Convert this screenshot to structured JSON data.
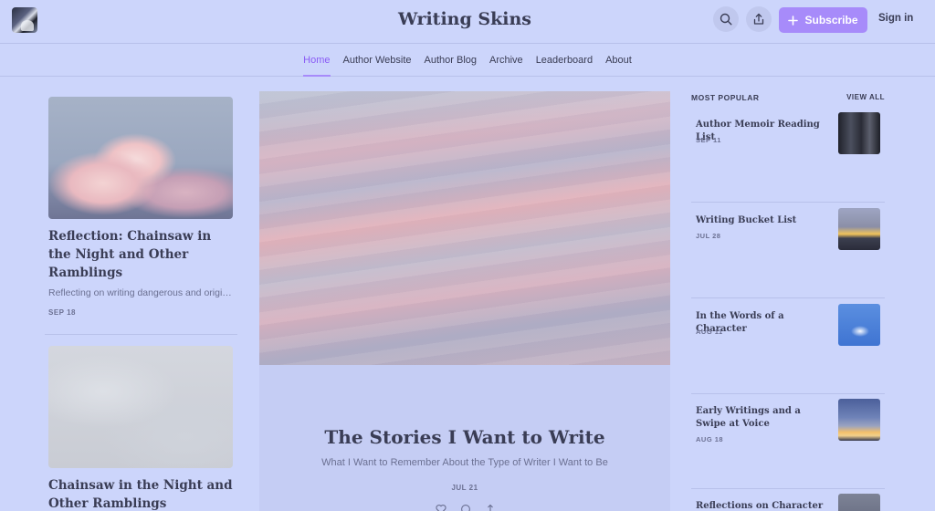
{
  "header": {
    "site_title": "Writing Skins",
    "subscribe_label": "Subscribe",
    "signin_label": "Sign in"
  },
  "nav": {
    "items": [
      {
        "label": "Home"
      },
      {
        "label": "Author Website"
      },
      {
        "label": "Author Blog"
      },
      {
        "label": "Archive"
      },
      {
        "label": "Leaderboard"
      },
      {
        "label": "About"
      }
    ]
  },
  "left_posts": [
    {
      "title": "Reflection: Chainsaw in the Night and Other Ramblings",
      "subtitle": "Reflecting on writing dangerous and origin...",
      "date": "SEP 18"
    },
    {
      "title": "Chainsaw in the Night and Other Ramblings",
      "subtitle": "",
      "date": ""
    }
  ],
  "featured": {
    "title": "The Stories I Want to Write",
    "subtitle": "What I Want to Remember About the Type of Writer I Want to Be",
    "date": "JUL 21"
  },
  "popular": {
    "label": "MOST POPULAR",
    "view_all": "VIEW ALL",
    "items": [
      {
        "title": "Author Memoir Reading List",
        "date": "SEP 11"
      },
      {
        "title": "Writing Bucket List",
        "date": "JUL 28"
      },
      {
        "title": "In the Words of a Character",
        "date": "AUG 11"
      },
      {
        "title": "Early Writings and a Swipe at Voice",
        "date": "AUG 18"
      },
      {
        "title": "Reflections on Character voice",
        "date": ""
      }
    ]
  },
  "colors": {
    "background": "#ccd5fb",
    "accent": "#a78bfa",
    "text": "#3a3d55"
  },
  "icons": [
    "logo-image",
    "search-icon",
    "share-icon",
    "plus-icon",
    "heart-icon",
    "comment-icon",
    "share-arrow-icon"
  ]
}
